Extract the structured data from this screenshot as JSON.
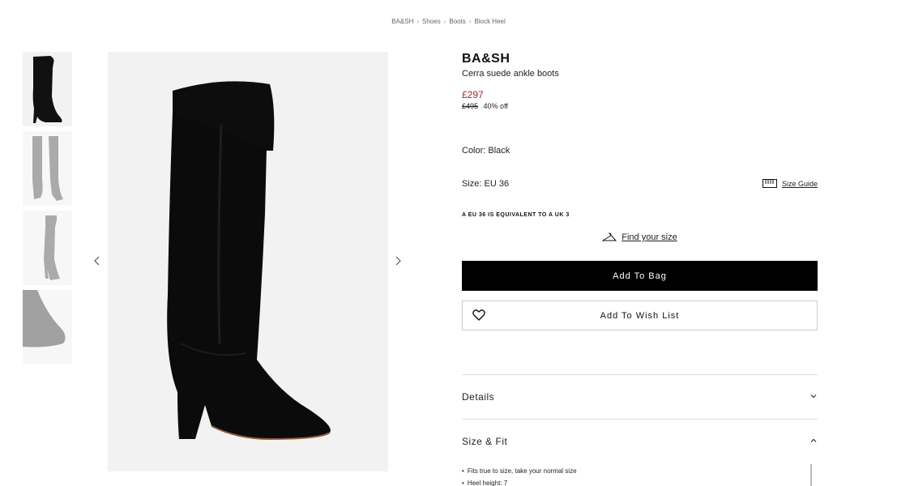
{
  "breadcrumb": [
    "BA&SH",
    "Shoes",
    "Boots",
    "Block Heel"
  ],
  "breadcrumb_sep": "›",
  "product": {
    "brand": "BA&SH",
    "name": "Cerra suede ankle boots",
    "price": "£297",
    "original_price": "£495",
    "discount": "40% off"
  },
  "color_label": "Color: Black",
  "size_label": "Size: EU 36",
  "size_guide_label": "Size Guide",
  "size_equivalent": "A EU 36 IS EQUIVALENT TO A UK 3",
  "find_size_label": "Find your size",
  "add_to_bag_label": "Add To Bag",
  "add_to_wishlist_label": "Add To Wish List",
  "accordion": {
    "details": "Details",
    "size_fit": "Size & Fit"
  },
  "fit_bullets": [
    "Fits true to size, take your normal size",
    "Heel height: 7"
  ],
  "colors": {
    "price": "#a3262a",
    "button": "#000000",
    "image_bg": "#f2f2f2"
  },
  "icons": [
    "chevron-left-icon",
    "chevron-right-icon",
    "ruler-icon",
    "hanger-icon",
    "heart-icon",
    "chevron-down-icon",
    "chevron-up-icon"
  ]
}
